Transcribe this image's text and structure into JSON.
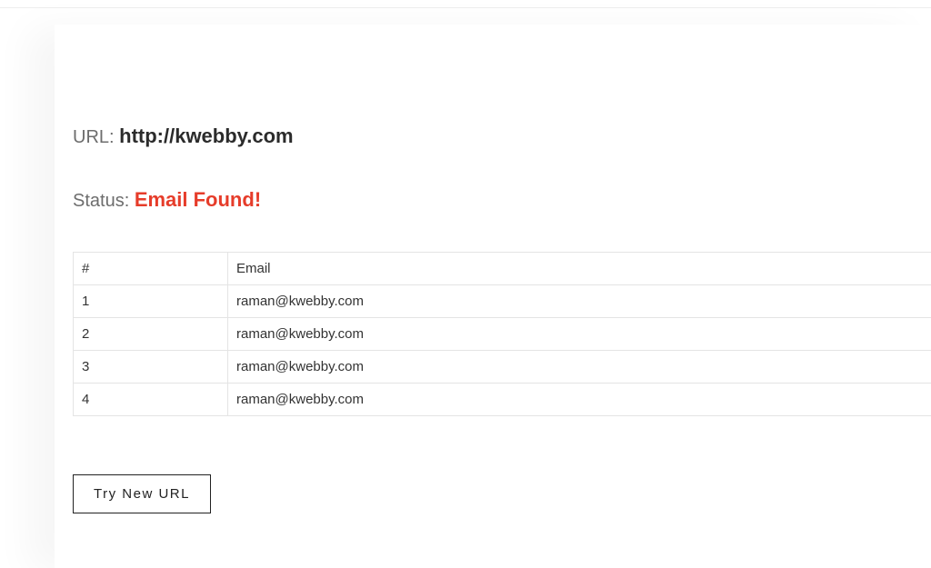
{
  "header": {
    "url_label": "URL: ",
    "url_value": "http://kwebby.com",
    "status_label": "Status: ",
    "status_value": "Email Found!"
  },
  "table": {
    "col_num": "#",
    "col_email": "Email",
    "rows": [
      {
        "num": "1",
        "email": "raman@kwebby.com"
      },
      {
        "num": "2",
        "email": "raman@kwebby.com"
      },
      {
        "num": "3",
        "email": "raman@kwebby.com"
      },
      {
        "num": "4",
        "email": "raman@kwebby.com"
      }
    ]
  },
  "actions": {
    "try_new_url": "Try New URL"
  }
}
